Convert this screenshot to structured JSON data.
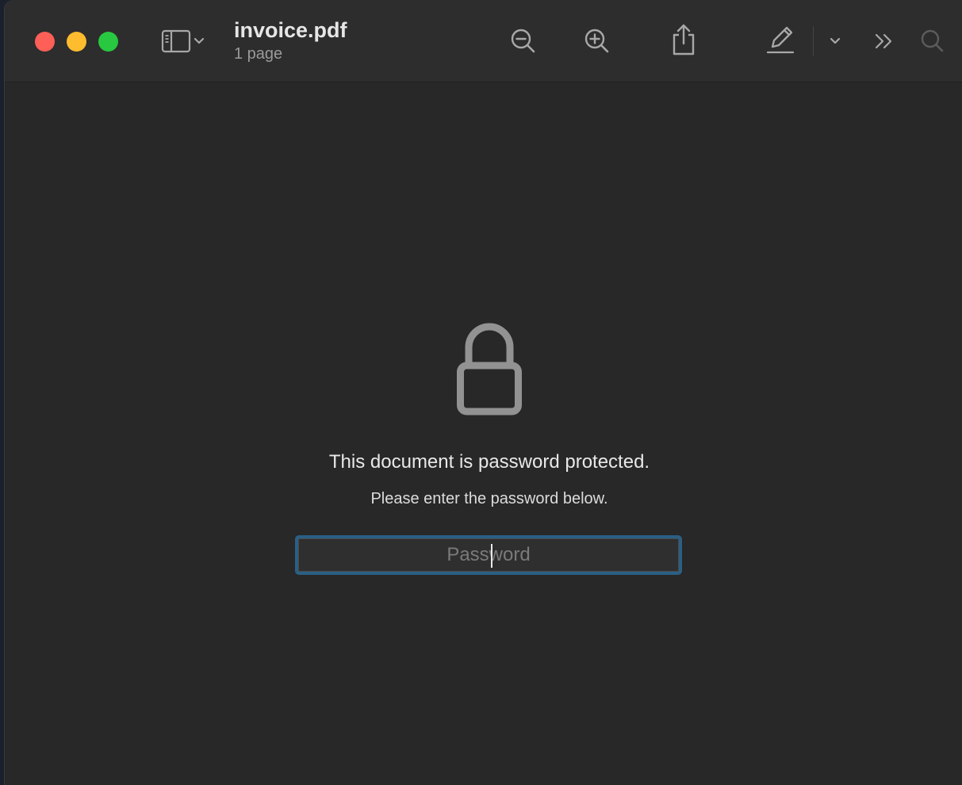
{
  "window": {
    "title": "invoice.pdf",
    "subtitle": "1 page"
  },
  "toolbar": {
    "icons": [
      "sidebar-icon",
      "chevron-down-icon",
      "zoom-out-icon",
      "zoom-in-icon",
      "share-icon",
      "markup-pencil-icon",
      "chevron-down-icon",
      "more-chevrons-icon",
      "search-icon"
    ]
  },
  "colors": {
    "close": "#fe5f57",
    "minimize": "#febc2e",
    "zoom": "#28c840",
    "focus_ring": "#2b5f85",
    "background": "#282828"
  },
  "lock_screen": {
    "title": "This document is password protected.",
    "subtitle": "Please enter the password below.",
    "password_placeholder": "Password",
    "password_value": ""
  }
}
